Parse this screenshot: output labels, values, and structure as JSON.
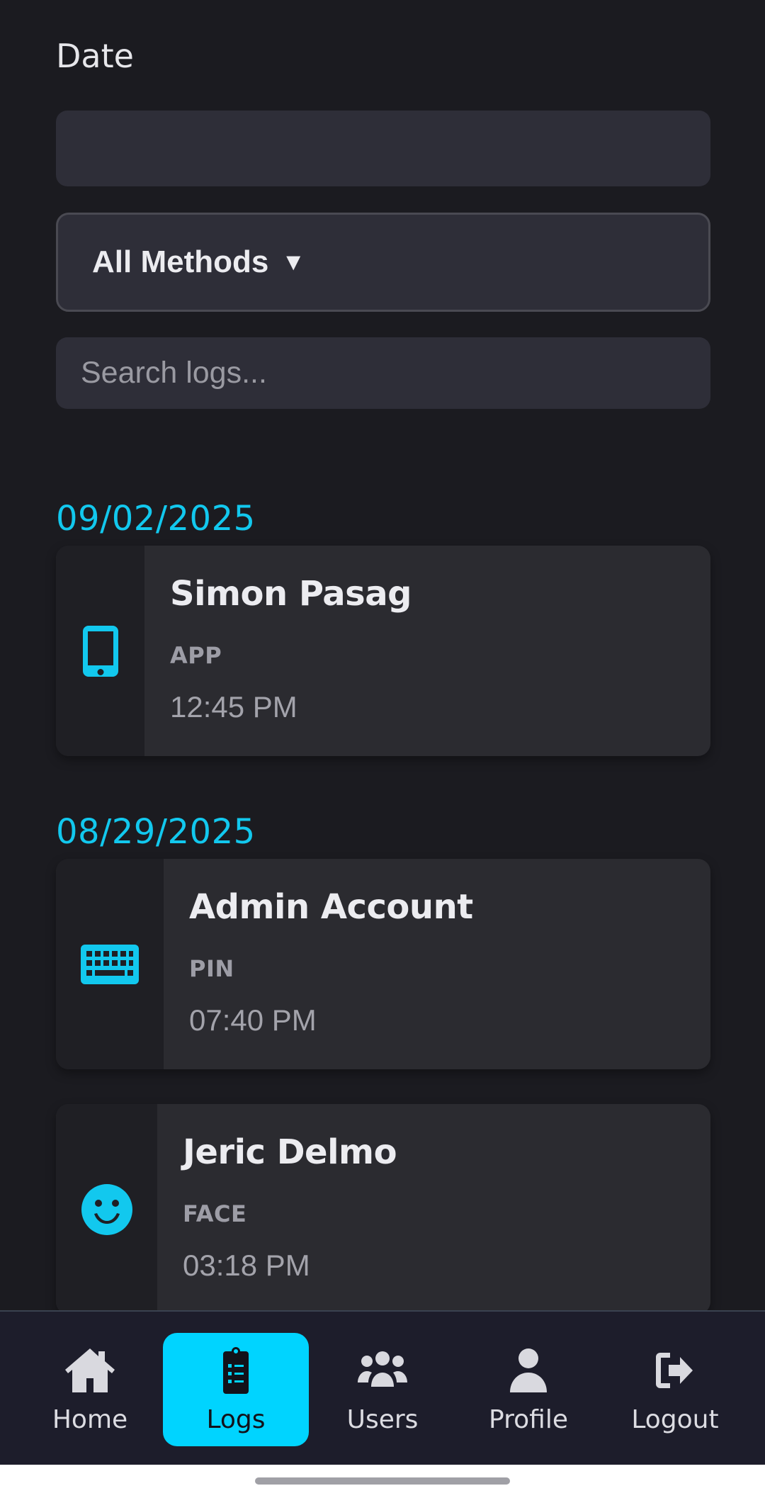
{
  "filters": {
    "date_label": "Date",
    "date_value": "",
    "method_selected": "All Methods",
    "method_caret": "▼",
    "search_placeholder": "Search logs...",
    "search_value": ""
  },
  "log_groups": [
    {
      "date": "09/02/2025",
      "entries": [
        {
          "name": "Simon Pasag",
          "method": "APP",
          "time": "12:45 PM",
          "icon": "mobile-phone-icon"
        }
      ]
    },
    {
      "date": "08/29/2025",
      "entries": [
        {
          "name": "Admin Account",
          "method": "PIN",
          "time": "07:40 PM",
          "icon": "keyboard-icon"
        },
        {
          "name": "Jeric Delmo",
          "method": "FACE",
          "time": "03:18 PM",
          "icon": "smiley-face-icon"
        }
      ]
    }
  ],
  "bottom_nav": {
    "items": [
      {
        "label": "Home",
        "icon": "home-icon"
      },
      {
        "label": "Logs",
        "icon": "clipboard-list-icon",
        "active": true
      },
      {
        "label": "Users",
        "icon": "users-icon"
      },
      {
        "label": "Profile",
        "icon": "user-icon"
      },
      {
        "label": "Logout",
        "icon": "sign-out-icon"
      }
    ]
  },
  "colors": {
    "background": "#1b1b20",
    "accent": "#00d4ff",
    "date_heading": "#12c8ee",
    "card": "#2b2b30",
    "input": "#2e2e38"
  }
}
